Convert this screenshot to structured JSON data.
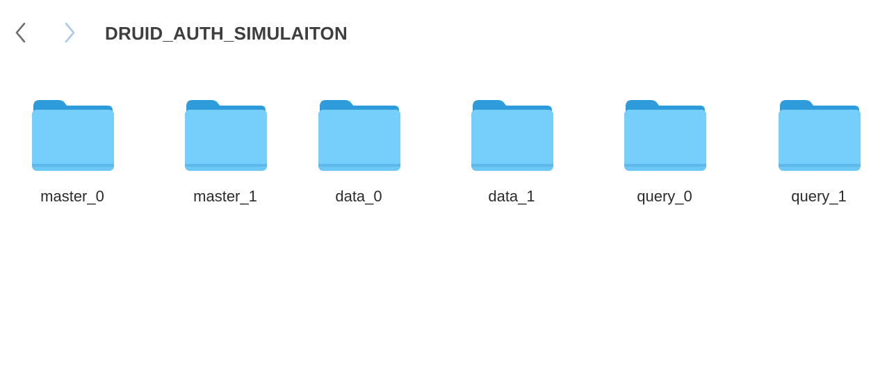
{
  "window": {
    "title": "DRUID_AUTH_SIMULAITON"
  },
  "toolbar": {
    "back_icon": "chevron-left-icon",
    "forward_icon": "chevron-right-icon"
  },
  "colors": {
    "folder_body": "#72CCFA",
    "folder_tab": "#2E9BDB",
    "title_text": "#3E3E3E",
    "nav_back": "#6E6E6E",
    "nav_forward": "#A9C9E6"
  },
  "folders": [
    {
      "name": "master_0",
      "icon": "folder-icon"
    },
    {
      "name": "master_1",
      "icon": "folder-icon"
    },
    {
      "name": "data_0",
      "icon": "folder-icon"
    },
    {
      "name": "data_1",
      "icon": "folder-icon"
    },
    {
      "name": "query_0",
      "icon": "folder-icon"
    },
    {
      "name": "query_1",
      "icon": "folder-icon"
    }
  ]
}
